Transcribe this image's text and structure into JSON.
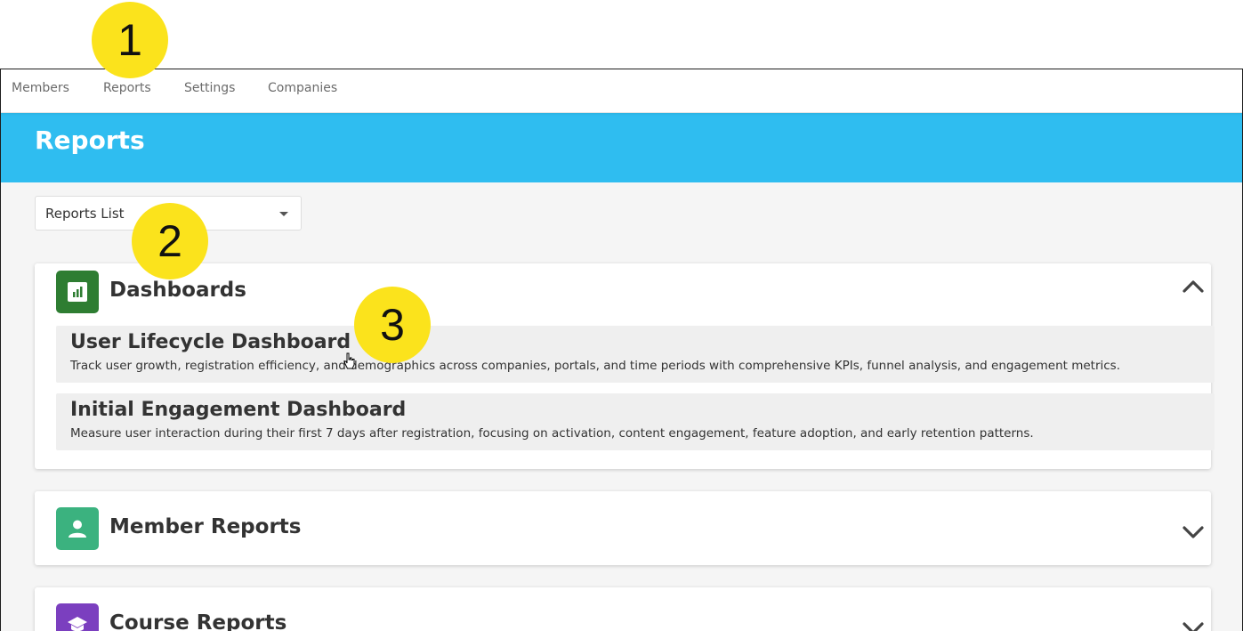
{
  "nav": {
    "items": [
      {
        "label": "Members"
      },
      {
        "label": "Reports"
      },
      {
        "label": "Settings"
      },
      {
        "label": "Companies"
      }
    ]
  },
  "page": {
    "title": "Reports"
  },
  "filter": {
    "selected": "Reports List"
  },
  "sections": {
    "dashboards": {
      "title": "Dashboards",
      "icon": "bar-chart-icon",
      "color": "#2e7d32",
      "expanded": true,
      "items": [
        {
          "title": "User Lifecycle Dashboard",
          "description": "Track user growth, registration efficiency, and demographics across companies, portals, and time periods with comprehensive KPIs, funnel analysis, and engagement metrics."
        },
        {
          "title": "Initial Engagement Dashboard",
          "description": "Measure user interaction during their first 7 days after registration, focusing on activation, content engagement, feature adoption, and early retention patterns."
        }
      ]
    },
    "member_reports": {
      "title": "Member Reports",
      "icon": "person-icon",
      "color": "#3bb27f",
      "expanded": false
    },
    "course_reports": {
      "title": "Course Reports",
      "icon": "graduation-cap-icon",
      "color": "#7b3fbf",
      "expanded": false
    }
  },
  "callouts": [
    "1",
    "2",
    "3"
  ],
  "colors": {
    "banner": "#2fbdf0",
    "callout": "#fbe31c"
  }
}
